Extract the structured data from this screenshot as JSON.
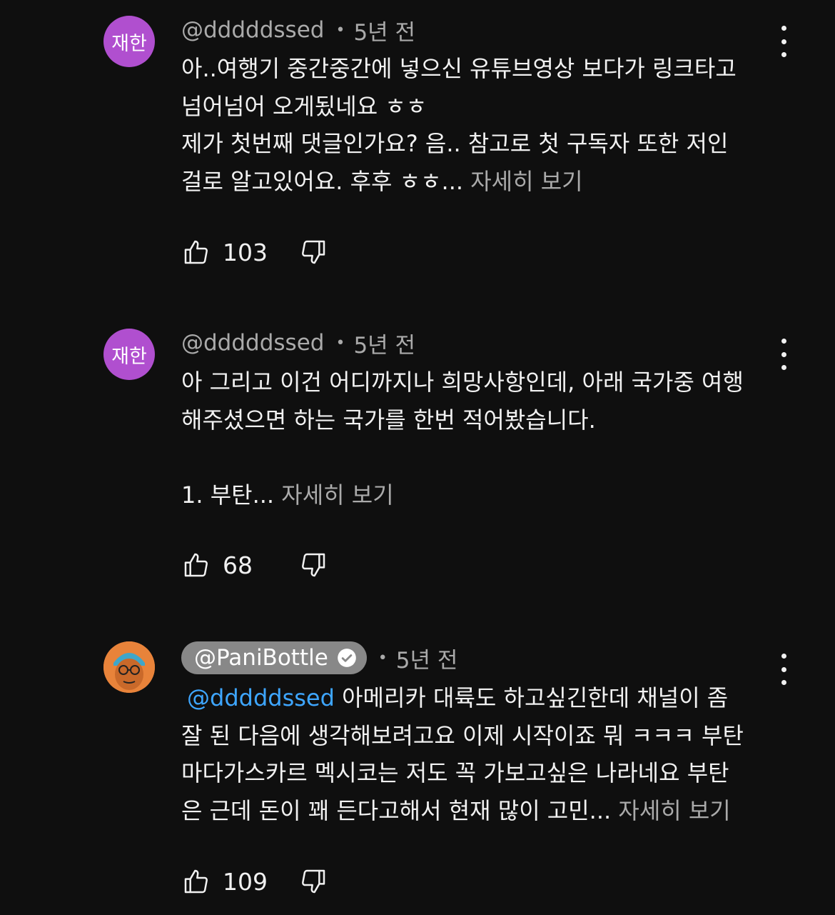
{
  "comments": [
    {
      "avatar_text": "재한",
      "author": "@dddddssed",
      "time": "5년 전",
      "lines": [
        "아..여행기 중간중간에 넣으신 유튜브영상 보다가 링크타고",
        "넘어넘어 오게됬네요 ㅎㅎ",
        "제가 첫번째 댓글인가요? 음.. 참고로 첫 구독자 또한 저인",
        "걸로 알고있어요. 후후 ㅎㅎ..."
      ],
      "more": "자세히 보기",
      "likes": "103"
    },
    {
      "avatar_text": "재한",
      "author": "@dddddssed",
      "time": "5년 전",
      "lines": [
        "아 그리고 이건 어디까지나 희망사항인데, 아래 국가중 여행",
        "해주셨으면 하는 국가를 한번 적어봤습니다.",
        "",
        "1. 부탄..."
      ],
      "more": "자세히 보기",
      "likes": "68"
    },
    {
      "author": "@PaniBottle",
      "time": "5년 전",
      "mention": "@dddddssed",
      "lines": [
        "아메리카 대륙도 하고싶긴한데 채널이 좀",
        "잘 된 다음에 생각해보려고요 이제 시작이죠 뭐 ㅋㅋㅋ 부탄",
        "마다가스카르 멕시코는 저도 꼭 가보고싶은 나라네요 부탄",
        "은 근데 돈이 꽤 든다고해서 현재 많이 고민..."
      ],
      "more": "자세히 보기",
      "likes": "109"
    }
  ],
  "colors": {
    "background": "#0f0f0f",
    "text": "#f1f1f1",
    "secondary_text": "#aaaaaa",
    "mention": "#3ea6ff",
    "avatar_purple": "#b04fcf",
    "creator_pill": "#888888"
  },
  "icons": [
    "like-icon",
    "dislike-icon",
    "more-options-icon",
    "verified-check-icon"
  ]
}
